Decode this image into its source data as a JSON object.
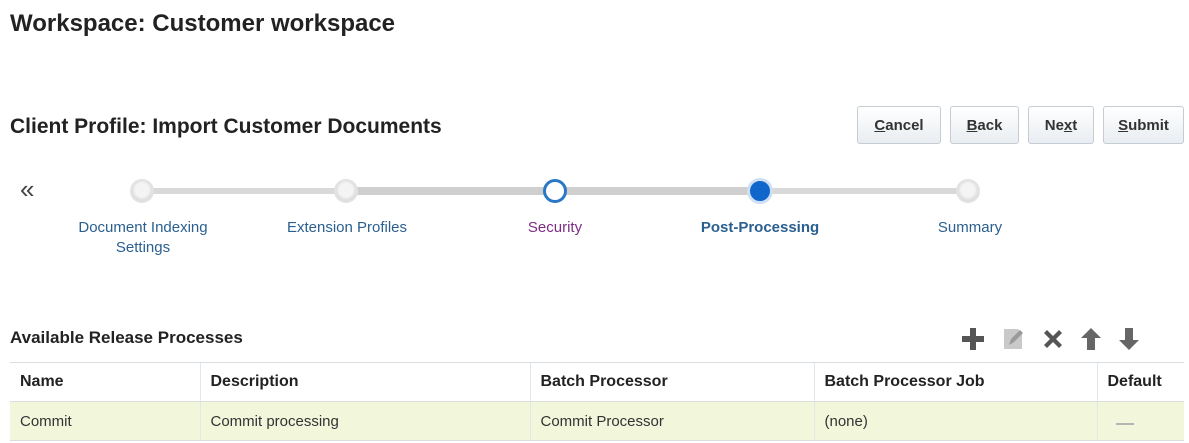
{
  "workspace_title": "Workspace: Customer workspace",
  "profile_title": "Client Profile: Import Customer Documents",
  "buttons": {
    "cancel": {
      "accesskey": "C",
      "rest": "ancel"
    },
    "back": {
      "accesskey": "B",
      "rest": "ack"
    },
    "next": {
      "prefix": "Ne",
      "accesskey": "x",
      "rest": "t"
    },
    "submit": {
      "accesskey": "S",
      "rest": "ubmit"
    }
  },
  "collapse_glyph": "«",
  "train": {
    "stops": [
      {
        "label_line1": "Document Indexing",
        "label_line2": "Settings",
        "state": "visited"
      },
      {
        "label": "Extension Profiles",
        "state": "visited"
      },
      {
        "label": "Security",
        "state": "visited"
      },
      {
        "label": "Post-Processing",
        "state": "current"
      },
      {
        "label": "Summary",
        "state": "unvisited"
      }
    ]
  },
  "section_title": "Available Release Processes",
  "tools": [
    "add-icon",
    "edit-icon",
    "delete-icon",
    "move-up-icon",
    "move-down-icon"
  ],
  "table": {
    "headers": [
      "Name",
      "Description",
      "Batch Processor",
      "Batch Processor Job",
      "Default"
    ],
    "rows": [
      {
        "name": "Commit",
        "description": "Commit processing",
        "batch_processor": "Commit Processor",
        "batch_processor_job": "(none)",
        "default": ""
      }
    ]
  },
  "colors": {
    "accent": "#1166cc",
    "link": "#2a5f8f",
    "visited_link": "#7b2d83",
    "row_highlight": "#f2f7dc"
  }
}
